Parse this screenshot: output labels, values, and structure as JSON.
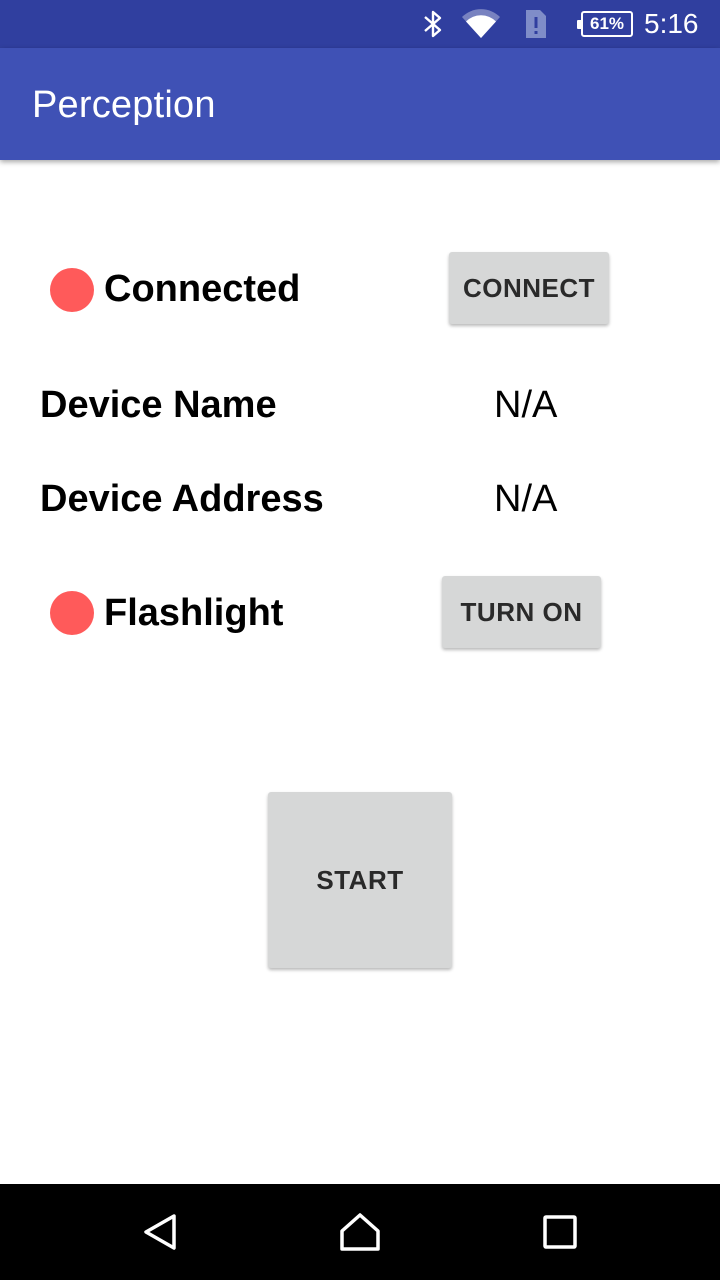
{
  "status_bar": {
    "battery_level": "61%",
    "time": "5:16",
    "icons": [
      "bluetooth-icon",
      "wifi-icon",
      "sim-alert-icon",
      "battery-icon"
    ],
    "background": "#303f9f"
  },
  "app_bar": {
    "title": "Perception",
    "background": "#3f51b5"
  },
  "connection": {
    "status_label": "Connected",
    "indicator_color": "#ff5a5a",
    "button_label": "CONNECT"
  },
  "device": {
    "name_label": "Device Name",
    "name_value": "N/A",
    "address_label": "Device Address",
    "address_value": "N/A"
  },
  "flashlight": {
    "status_label": "Flashlight",
    "indicator_color": "#ff5a5a",
    "button_label": "TURN ON"
  },
  "start_button": {
    "label": "START"
  },
  "nav_bar": {
    "icons": [
      "back-icon",
      "home-icon",
      "recents-icon"
    ]
  }
}
